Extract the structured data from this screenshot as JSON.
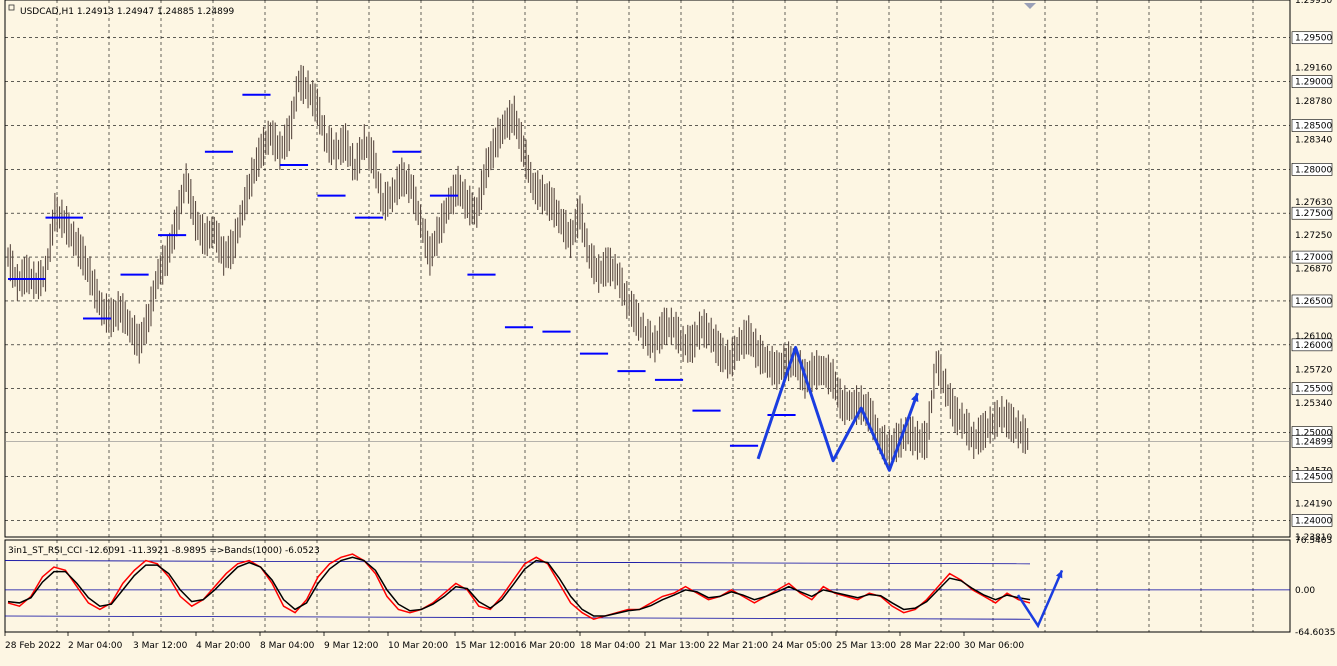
{
  "header": {
    "symbol_title": "USDCAD,H1  1.24913 1.24947 1.24885 1.24899"
  },
  "indicator": {
    "title": "3in1_ST_RSI_CCI -12.6091 -11.3921 -8.9895  =>Bands(1000) -6.0523",
    "axis_labels": [
      "76.5403",
      "0.00",
      "-64.6035"
    ]
  },
  "price_axis": {
    "tick_labels": [
      "1.29930",
      "1.29500",
      "1.29160",
      "1.29000",
      "1.28780",
      "1.28500",
      "1.28340",
      "1.28000",
      "1.27630",
      "1.27500",
      "1.27250",
      "1.27000",
      "1.26870",
      "1.26500",
      "1.26100",
      "1.26000",
      "1.25720",
      "1.25500",
      "1.25340",
      "1.25000",
      "1.24899",
      "1.24570",
      "1.24500",
      "1.24190",
      "1.24000",
      "1.23810"
    ],
    "highlighted_labels": [
      "1.29500",
      "1.29000",
      "1.28500",
      "1.28000",
      "1.27500",
      "1.27000",
      "1.26500",
      "1.26000",
      "1.25500",
      "1.25000",
      "1.24899",
      "1.24500",
      "1.24000"
    ]
  },
  "time_axis": {
    "labels": [
      "28 Feb 2022",
      "2 Mar 04:00",
      "3 Mar 12:00",
      "4 Mar 20:00",
      "8 Mar 04:00",
      "9 Mar 12:00",
      "10 Mar 20:00",
      "15 Mar 12:00",
      "16 Mar 20:00",
      "18 Mar 04:00",
      "21 Mar 13:00",
      "22 Mar 21:00",
      "24 Mar 05:00",
      "25 Mar 13:00",
      "28 Mar 22:00",
      "30 Mar 06:00"
    ]
  },
  "colors": {
    "background": "#fdf6e3",
    "bars": "#5a4a42",
    "levels": "#0000ff",
    "projection": "#1a3de0",
    "indicator_main": "#ff0000",
    "indicator_signal": "#000000",
    "bands": "#0000a0",
    "grid": "#000000"
  },
  "chart_data": [
    {
      "type": "ohlc",
      "symbol": "USDCAD",
      "timeframe": "H1",
      "last": {
        "open": 1.24913,
        "high": 1.24947,
        "low": 1.24885,
        "close": 1.24899
      },
      "ylim": [
        1.2381,
        1.2993
      ],
      "close_path": [
        [
          0,
          1.27
        ],
        [
          1,
          1.267
        ],
        [
          2,
          1.268
        ],
        [
          3,
          1.267
        ],
        [
          4,
          1.268
        ],
        [
          5,
          1.275
        ],
        [
          6,
          1.274
        ],
        [
          7,
          1.272
        ],
        [
          8,
          1.27
        ],
        [
          9,
          1.267
        ],
        [
          10,
          1.264
        ],
        [
          11,
          1.263
        ],
        [
          12,
          1.264
        ],
        [
          13,
          1.262
        ],
        [
          14,
          1.26
        ],
        [
          15,
          1.263
        ],
        [
          16,
          1.268
        ],
        [
          17,
          1.27
        ],
        [
          18,
          1.274
        ],
        [
          19,
          1.279
        ],
        [
          20,
          1.274
        ],
        [
          21,
          1.272
        ],
        [
          22,
          1.273
        ],
        [
          23,
          1.27
        ],
        [
          24,
          1.271
        ],
        [
          25,
          1.275
        ],
        [
          26,
          1.279
        ],
        [
          27,
          1.282
        ],
        [
          28,
          1.284
        ],
        [
          29,
          1.282
        ],
        [
          30,
          1.284
        ],
        [
          31,
          1.29
        ],
        [
          32,
          1.289
        ],
        [
          33,
          1.287
        ],
        [
          34,
          1.283
        ],
        [
          35,
          1.282
        ],
        [
          36,
          1.283
        ],
        [
          37,
          1.28
        ],
        [
          38,
          1.283
        ],
        [
          39,
          1.281
        ],
        [
          40,
          1.276
        ],
        [
          41,
          1.277
        ],
        [
          42,
          1.279
        ],
        [
          43,
          1.278
        ],
        [
          44,
          1.274
        ],
        [
          45,
          1.27
        ],
        [
          46,
          1.273
        ],
        [
          47,
          1.276
        ],
        [
          48,
          1.278
        ],
        [
          49,
          1.276
        ],
        [
          50,
          1.275
        ],
        [
          51,
          1.28
        ],
        [
          52,
          1.283
        ],
        [
          53,
          1.285
        ],
        [
          54,
          1.286
        ],
        [
          55,
          1.282
        ],
        [
          56,
          1.278
        ],
        [
          57,
          1.277
        ],
        [
          58,
          1.276
        ],
        [
          59,
          1.274
        ],
        [
          60,
          1.272
        ],
        [
          61,
          1.275
        ],
        [
          62,
          1.27
        ],
        [
          63,
          1.268
        ],
        [
          64,
          1.269
        ],
        [
          65,
          1.268
        ],
        [
          66,
          1.265
        ],
        [
          67,
          1.263
        ],
        [
          68,
          1.261
        ],
        [
          69,
          1.26
        ],
        [
          70,
          1.262
        ],
        [
          71,
          1.262
        ],
        [
          72,
          1.26
        ],
        [
          73,
          1.26
        ],
        [
          74,
          1.262
        ],
        [
          75,
          1.261
        ],
        [
          76,
          1.259
        ],
        [
          77,
          1.258
        ],
        [
          78,
          1.26
        ],
        [
          79,
          1.261
        ],
        [
          80,
          1.259
        ],
        [
          81,
          1.258
        ],
        [
          82,
          1.257
        ],
        [
          83,
          1.258
        ],
        [
          84,
          1.258
        ],
        [
          85,
          1.256
        ],
        [
          86,
          1.257
        ],
        [
          87,
          1.257
        ],
        [
          88,
          1.256
        ],
        [
          89,
          1.253
        ],
        [
          90,
          1.253
        ],
        [
          91,
          1.253
        ],
        [
          92,
          1.252
        ],
        [
          93,
          1.249
        ],
        [
          94,
          1.248
        ],
        [
          95,
          1.249
        ],
        [
          96,
          1.25
        ],
        [
          97,
          1.249
        ],
        [
          98,
          1.249
        ],
        [
          99,
          1.258
        ],
        [
          100,
          1.255
        ],
        [
          101,
          1.252
        ],
        [
          102,
          1.251
        ],
        [
          103,
          1.249
        ],
        [
          104,
          1.25
        ],
        [
          105,
          1.251
        ],
        [
          106,
          1.252
        ],
        [
          107,
          1.251
        ],
        [
          108,
          1.25
        ],
        [
          109,
          1.249
        ]
      ],
      "level_segments": [
        {
          "x": [
            0,
            4
          ],
          "y": 1.2675
        },
        {
          "x": [
            4,
            8
          ],
          "y": 1.2745
        },
        {
          "x": [
            8,
            11
          ],
          "y": 1.263
        },
        {
          "x": [
            12,
            15
          ],
          "y": 1.268
        },
        {
          "x": [
            16,
            19
          ],
          "y": 1.2725
        },
        {
          "x": [
            21,
            24
          ],
          "y": 1.282
        },
        {
          "x": [
            25,
            28
          ],
          "y": 1.2885
        },
        {
          "x": [
            29,
            32
          ],
          "y": 1.2805
        },
        {
          "x": [
            33,
            36
          ],
          "y": 1.277
        },
        {
          "x": [
            37,
            40
          ],
          "y": 1.2745
        },
        {
          "x": [
            41,
            44
          ],
          "y": 1.282
        },
        {
          "x": [
            45,
            48
          ],
          "y": 1.277
        },
        {
          "x": [
            49,
            52
          ],
          "y": 1.268
        },
        {
          "x": [
            53,
            56
          ],
          "y": 1.262
        },
        {
          "x": [
            57,
            60
          ],
          "y": 1.2615
        },
        {
          "x": [
            61,
            64
          ],
          "y": 1.259
        },
        {
          "x": [
            65,
            68
          ],
          "y": 1.257
        },
        {
          "x": [
            69,
            72
          ],
          "y": 1.256
        },
        {
          "x": [
            73,
            76
          ],
          "y": 1.2525
        },
        {
          "x": [
            77,
            80
          ],
          "y": 1.2485
        },
        {
          "x": [
            81,
            84
          ],
          "y": 1.252
        }
      ],
      "projection": [
        [
          80,
          1.247
        ],
        [
          84,
          1.2597
        ],
        [
          88,
          1.2468
        ],
        [
          91,
          1.2528
        ],
        [
          94,
          1.2457
        ],
        [
          97,
          1.2545
        ]
      ]
    },
    {
      "type": "line",
      "title": "3in1_ST_RSI_CCI",
      "ylim": [
        -64.6035,
        76.5403
      ],
      "series": [
        {
          "values": [
            -20,
            -25,
            -10,
            20,
            35,
            30,
            5,
            -20,
            -30,
            -20,
            10,
            30,
            45,
            40,
            20,
            -10,
            -25,
            -15,
            5,
            25,
            40,
            45,
            35,
            10,
            -25,
            -35,
            -15,
            20,
            40,
            50,
            55,
            45,
            25,
            -10,
            -30,
            -35,
            -30,
            -20,
            -5,
            10,
            0,
            -25,
            -30,
            -10,
            15,
            40,
            50,
            40,
            10,
            -20,
            -35,
            -45,
            -40,
            -35,
            -30,
            -30,
            -20,
            -10,
            -5,
            5,
            -5,
            -15,
            -10,
            0,
            -10,
            -20,
            -10,
            0,
            10,
            -5,
            -15,
            5,
            -5,
            -10,
            -15,
            -5,
            -10,
            -25,
            -35,
            -30,
            -15,
            5,
            25,
            15,
            0,
            -10,
            -20,
            -5,
            -15,
            -20
          ]
        },
        {
          "values": [
            -18,
            -20,
            -12,
            12,
            28,
            28,
            10,
            -12,
            -25,
            -22,
            0,
            22,
            38,
            38,
            25,
            0,
            -18,
            -15,
            0,
            18,
            35,
            42,
            35,
            15,
            -15,
            -30,
            -20,
            10,
            32,
            45,
            50,
            45,
            30,
            0,
            -22,
            -32,
            -30,
            -22,
            -10,
            5,
            2,
            -18,
            -28,
            -15,
            8,
            32,
            45,
            42,
            18,
            -10,
            -30,
            -40,
            -40,
            -36,
            -32,
            -30,
            -24,
            -15,
            -8,
            0,
            -3,
            -12,
            -10,
            -3,
            -8,
            -15,
            -10,
            -3,
            5,
            -3,
            -10,
            0,
            -4,
            -8,
            -12,
            -7,
            -9,
            -20,
            -30,
            -28,
            -18,
            0,
            18,
            14,
            2,
            -8,
            -15,
            -8,
            -12,
            -15
          ]
        }
      ]
    }
  ]
}
